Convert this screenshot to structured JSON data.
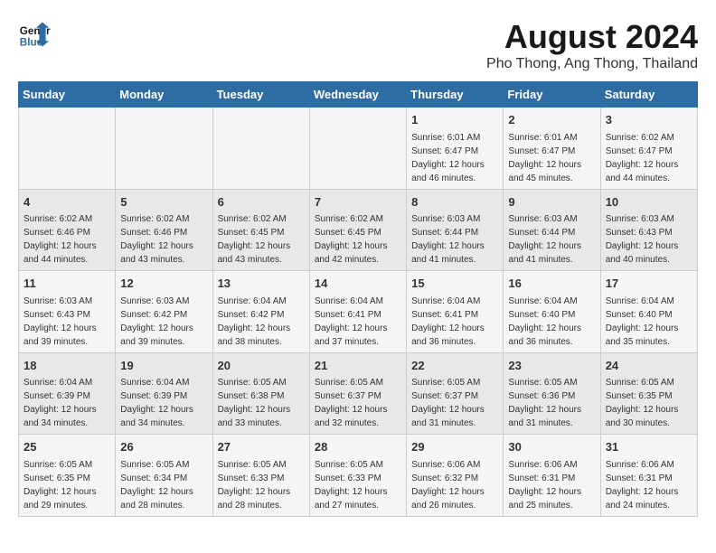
{
  "header": {
    "logo_line1": "General",
    "logo_line2": "Blue",
    "month_title": "August 2024",
    "location": "Pho Thong, Ang Thong, Thailand"
  },
  "weekdays": [
    "Sunday",
    "Monday",
    "Tuesday",
    "Wednesday",
    "Thursday",
    "Friday",
    "Saturday"
  ],
  "weeks": [
    [
      {
        "day": "",
        "info": ""
      },
      {
        "day": "",
        "info": ""
      },
      {
        "day": "",
        "info": ""
      },
      {
        "day": "",
        "info": ""
      },
      {
        "day": "1",
        "info": "Sunrise: 6:01 AM\nSunset: 6:47 PM\nDaylight: 12 hours\nand 46 minutes."
      },
      {
        "day": "2",
        "info": "Sunrise: 6:01 AM\nSunset: 6:47 PM\nDaylight: 12 hours\nand 45 minutes."
      },
      {
        "day": "3",
        "info": "Sunrise: 6:02 AM\nSunset: 6:47 PM\nDaylight: 12 hours\nand 44 minutes."
      }
    ],
    [
      {
        "day": "4",
        "info": "Sunrise: 6:02 AM\nSunset: 6:46 PM\nDaylight: 12 hours\nand 44 minutes."
      },
      {
        "day": "5",
        "info": "Sunrise: 6:02 AM\nSunset: 6:46 PM\nDaylight: 12 hours\nand 43 minutes."
      },
      {
        "day": "6",
        "info": "Sunrise: 6:02 AM\nSunset: 6:45 PM\nDaylight: 12 hours\nand 43 minutes."
      },
      {
        "day": "7",
        "info": "Sunrise: 6:02 AM\nSunset: 6:45 PM\nDaylight: 12 hours\nand 42 minutes."
      },
      {
        "day": "8",
        "info": "Sunrise: 6:03 AM\nSunset: 6:44 PM\nDaylight: 12 hours\nand 41 minutes."
      },
      {
        "day": "9",
        "info": "Sunrise: 6:03 AM\nSunset: 6:44 PM\nDaylight: 12 hours\nand 41 minutes."
      },
      {
        "day": "10",
        "info": "Sunrise: 6:03 AM\nSunset: 6:43 PM\nDaylight: 12 hours\nand 40 minutes."
      }
    ],
    [
      {
        "day": "11",
        "info": "Sunrise: 6:03 AM\nSunset: 6:43 PM\nDaylight: 12 hours\nand 39 minutes."
      },
      {
        "day": "12",
        "info": "Sunrise: 6:03 AM\nSunset: 6:42 PM\nDaylight: 12 hours\nand 39 minutes."
      },
      {
        "day": "13",
        "info": "Sunrise: 6:04 AM\nSunset: 6:42 PM\nDaylight: 12 hours\nand 38 minutes."
      },
      {
        "day": "14",
        "info": "Sunrise: 6:04 AM\nSunset: 6:41 PM\nDaylight: 12 hours\nand 37 minutes."
      },
      {
        "day": "15",
        "info": "Sunrise: 6:04 AM\nSunset: 6:41 PM\nDaylight: 12 hours\nand 36 minutes."
      },
      {
        "day": "16",
        "info": "Sunrise: 6:04 AM\nSunset: 6:40 PM\nDaylight: 12 hours\nand 36 minutes."
      },
      {
        "day": "17",
        "info": "Sunrise: 6:04 AM\nSunset: 6:40 PM\nDaylight: 12 hours\nand 35 minutes."
      }
    ],
    [
      {
        "day": "18",
        "info": "Sunrise: 6:04 AM\nSunset: 6:39 PM\nDaylight: 12 hours\nand 34 minutes."
      },
      {
        "day": "19",
        "info": "Sunrise: 6:04 AM\nSunset: 6:39 PM\nDaylight: 12 hours\nand 34 minutes."
      },
      {
        "day": "20",
        "info": "Sunrise: 6:05 AM\nSunset: 6:38 PM\nDaylight: 12 hours\nand 33 minutes."
      },
      {
        "day": "21",
        "info": "Sunrise: 6:05 AM\nSunset: 6:37 PM\nDaylight: 12 hours\nand 32 minutes."
      },
      {
        "day": "22",
        "info": "Sunrise: 6:05 AM\nSunset: 6:37 PM\nDaylight: 12 hours\nand 31 minutes."
      },
      {
        "day": "23",
        "info": "Sunrise: 6:05 AM\nSunset: 6:36 PM\nDaylight: 12 hours\nand 31 minutes."
      },
      {
        "day": "24",
        "info": "Sunrise: 6:05 AM\nSunset: 6:35 PM\nDaylight: 12 hours\nand 30 minutes."
      }
    ],
    [
      {
        "day": "25",
        "info": "Sunrise: 6:05 AM\nSunset: 6:35 PM\nDaylight: 12 hours\nand 29 minutes."
      },
      {
        "day": "26",
        "info": "Sunrise: 6:05 AM\nSunset: 6:34 PM\nDaylight: 12 hours\nand 28 minutes."
      },
      {
        "day": "27",
        "info": "Sunrise: 6:05 AM\nSunset: 6:33 PM\nDaylight: 12 hours\nand 28 minutes."
      },
      {
        "day": "28",
        "info": "Sunrise: 6:05 AM\nSunset: 6:33 PM\nDaylight: 12 hours\nand 27 minutes."
      },
      {
        "day": "29",
        "info": "Sunrise: 6:06 AM\nSunset: 6:32 PM\nDaylight: 12 hours\nand 26 minutes."
      },
      {
        "day": "30",
        "info": "Sunrise: 6:06 AM\nSunset: 6:31 PM\nDaylight: 12 hours\nand 25 minutes."
      },
      {
        "day": "31",
        "info": "Sunrise: 6:06 AM\nSunset: 6:31 PM\nDaylight: 12 hours\nand 24 minutes."
      }
    ]
  ]
}
